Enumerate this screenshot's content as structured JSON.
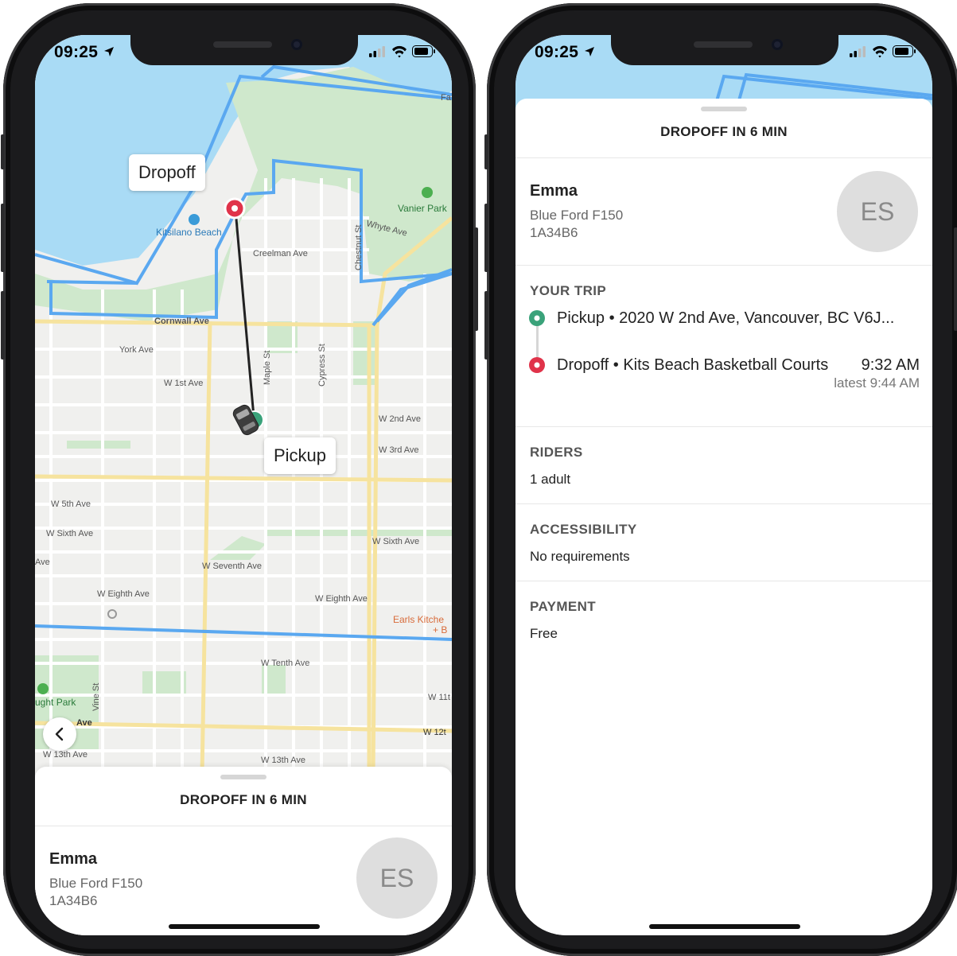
{
  "status_bar": {
    "time": "09:25"
  },
  "map": {
    "dropoff_label": "Dropoff",
    "pickup_label": "Pickup",
    "streets": {
      "kitsilano_beach": "Kitsilano Beach",
      "vanier_park": "Vanier Park",
      "whyte_ave": "Whyte Ave",
      "creelman_ave": "Creelman Ave",
      "chestnut_st": "Chestnut St",
      "cornwall_ave": "Cornwall Ave",
      "york_ave": "York Ave",
      "w_1st_ave": "W 1st Ave",
      "maple_st": "Maple St",
      "cypress_st": "Cypress St",
      "w_2nd_ave": "W 2nd Ave",
      "w_3rd_ave": "W 3rd Ave",
      "w_5th_ave": "W 5th Ave",
      "w_sixth_ave_left": "W Sixth Ave",
      "w_sixth_ave_right": "W Sixth Ave",
      "w_seventh_ave": "W Seventh Ave",
      "w_eighth_ave_left": "W Eighth Ave",
      "w_eighth_ave_right": "W Eighth Ave",
      "earls_kitchen": "Earls Kitche",
      "earls_kitchen_2": "+ B",
      "w_tenth_ave": "W Tenth Ave",
      "knight_park": "ught Park",
      "vine_st": "Vine St",
      "w_11th": "W 11t",
      "w_12th": "W 12t",
      "w_13th_ave_left": "W 13th Ave",
      "w_13th_ave_mid": "W 13th Ave",
      "fa": "Fa",
      "ave_left": "Ave",
      "ave_bold": "Ave"
    }
  },
  "sheet": {
    "title": "DROPOFF IN 6 MIN",
    "driver": {
      "name": "Emma",
      "car": "Blue Ford F150",
      "plate": "1A34B6",
      "initials": "ES"
    },
    "trip": {
      "heading": "YOUR TRIP",
      "pickup": "Pickup • 2020 W 2nd Ave, Vancouver, BC V6J...",
      "dropoff": "Dropoff • Kits Beach Basketball Courts",
      "dropoff_time": "9:32 AM",
      "latest": "latest 9:44 AM"
    },
    "riders": {
      "heading": "RIDERS",
      "value": "1 adult"
    },
    "accessibility": {
      "heading": "ACCESSIBILITY",
      "value": "No requirements"
    },
    "payment": {
      "heading": "PAYMENT",
      "value": "Free"
    }
  },
  "colors": {
    "water": "#a9dbf5",
    "land": "#f2f2f2",
    "park": "#c8e6c5",
    "boundary": "#5aa8f0",
    "road_major": "#f6e39e",
    "dropoff_pin": "#e0334a",
    "pickup_pin": "#3aa27a"
  },
  "icons": [
    "location-arrow-icon",
    "signal-icon",
    "wifi-icon",
    "battery-icon",
    "chevron-left-icon",
    "dropoff-pin-icon",
    "pickup-pin-icon",
    "car-icon"
  ]
}
